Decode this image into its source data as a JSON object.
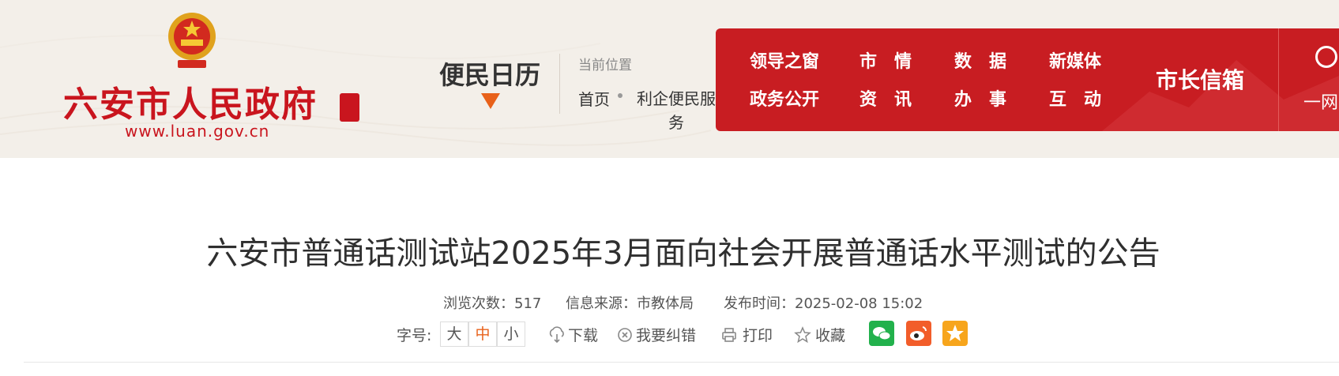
{
  "header": {
    "site_name": "六安市人民政府",
    "site_url": "www.luan.gov.cn",
    "calendar_label": "便民日历",
    "location_label": "当前位置",
    "breadcrumb": {
      "home": "首页",
      "current": "利企便民服务"
    },
    "nav": {
      "items": [
        {
          "label": "领导之窗"
        },
        {
          "label": "市　情"
        },
        {
          "label": "数　据"
        },
        {
          "label": "新媒体"
        },
        {
          "label": "政务公开"
        },
        {
          "label": "资　讯"
        },
        {
          "label": "办　事"
        },
        {
          "label": "互　动"
        }
      ],
      "mayor_mailbox": "市长信箱",
      "search_text": "一网"
    }
  },
  "article": {
    "title": "六安市普通话测试站2025年3月面向社会开展普通话水平测试的公告",
    "views_label": "浏览次数：",
    "views": "517",
    "source_label": "信息来源：",
    "source": "市教体局",
    "published_label": "发布时间：",
    "published": "2025-02-08 15:02"
  },
  "toolbar": {
    "font_size_label": "字号:",
    "font_sizes": [
      "大",
      "中",
      "小"
    ],
    "selected_font_size": "中",
    "download": "下载",
    "report_error": "我要纠错",
    "print": "打印",
    "favorite": "收藏"
  },
  "share_icons": [
    "wechat-icon",
    "weibo-icon",
    "qzone-icon"
  ],
  "colors": {
    "brand_red": "#c81d22",
    "accent_orange": "#e8611a",
    "wechat_green": "#22b14c",
    "weibo_orange": "#f25d2a",
    "qzone_orange": "#f7a51c"
  }
}
